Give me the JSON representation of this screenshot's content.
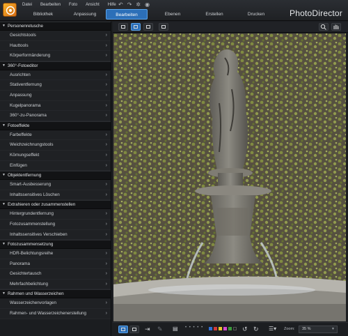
{
  "app": {
    "brand": "PhotoDirector",
    "menu": [
      "Datei",
      "Bearbeiten",
      "Foto",
      "Ansicht",
      "Hilfe"
    ],
    "tabs": [
      "Bibliothek",
      "Anpassung",
      "Bearbeiten",
      "Ebenen",
      "Erstellen",
      "Drucken"
    ],
    "active_tab": "Bearbeiten"
  },
  "sidebar": {
    "sections": [
      {
        "title": "Personenretusche",
        "items": [
          "Gesichtstools",
          "Hauttools",
          "Körperformänderung"
        ]
      },
      {
        "title": "360°-Fotoeditor",
        "items": [
          "Ausrichten",
          "Stativentfernung",
          "Anpassung",
          "Kugelpanorama",
          "360°-zu-Panorama"
        ]
      },
      {
        "title": "Fotoeffekte",
        "items": [
          "Farbeffekte",
          "Weichzeichnungstools",
          "Körnungseffekt",
          "Einfügen"
        ]
      },
      {
        "title": "Objektentfernung",
        "items": [
          "Smart-Ausbesserung",
          "Inhaltssensitives Löschen"
        ]
      },
      {
        "title": "Extrahieren oder zusammenstellen",
        "items": [
          "Hintergrundentfernung",
          "Fotozusammenstellung",
          "Inhaltssensitives Verschieben"
        ]
      },
      {
        "title": "Fotozusammensetzung",
        "items": [
          "HDR-Belichtungsreihe",
          "Panorama",
          "Gesichtertausch",
          "Mehrfachbelichtung"
        ]
      },
      {
        "title": "Rahmen und Wasserzeichen",
        "items": [
          "Wasserzeichenvorlagen",
          "Rahmen- und Wasserzeichenerstellung"
        ]
      }
    ]
  },
  "bottombar": {
    "zoom_label": "Zoom:",
    "zoom_value": "35 %",
    "colors": [
      "#2f6fd6",
      "#d23a3a",
      "#e7c52a",
      "#d24bd0",
      "#3a9a3a",
      "#1f1f1f"
    ]
  },
  "icons": {
    "search": "magnifier-icon",
    "hand": "hand-icon"
  }
}
